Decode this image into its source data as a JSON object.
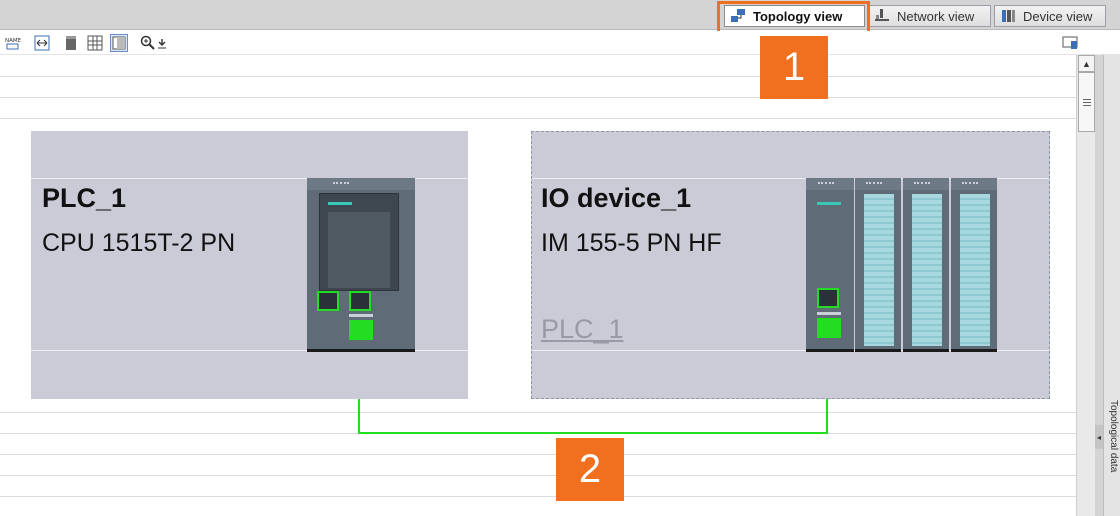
{
  "view_tabs": [
    {
      "label": "Topology view",
      "icon": "topology-icon",
      "active": true
    },
    {
      "label": "Network view",
      "icon": "network-icon",
      "active": false
    },
    {
      "label": "Device view",
      "icon": "device-icon",
      "active": false
    }
  ],
  "toolbar": {
    "icons": [
      "show-names-icon",
      "fit-view-icon",
      "page-icon",
      "grid-icon",
      "table-icon",
      "zoom-icon",
      "download-arrow-icon"
    ],
    "right_icon": "panel-toggle-icon"
  },
  "devices": [
    {
      "name": "PLC_1",
      "type": "CPU 1515T-2 PN",
      "assignment": ""
    },
    {
      "name": "IO device_1",
      "type": "IM 155-5 PN HF",
      "assignment": "PLC_1"
    }
  ],
  "callouts": [
    "1",
    "2"
  ],
  "side_panel": {
    "label": "Topological data"
  },
  "colors": {
    "highlight": "#f07020",
    "port_green": "#22dd22",
    "device_bg": "#cbcbd8"
  }
}
